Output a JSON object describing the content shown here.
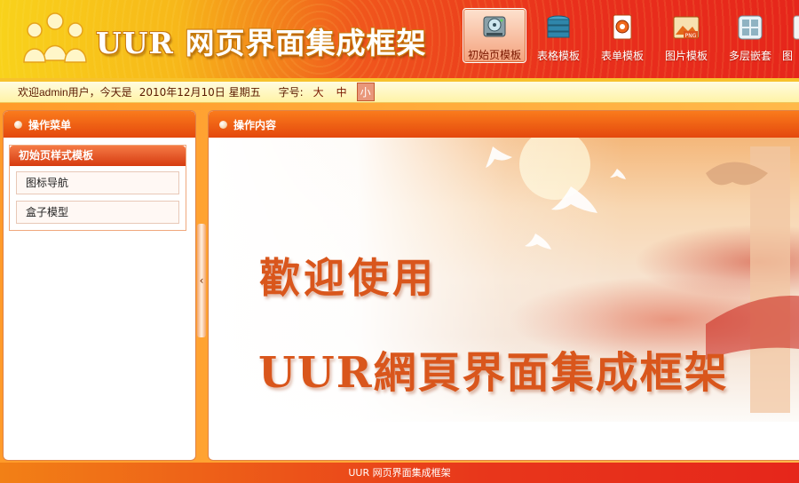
{
  "header": {
    "title": "UUR 网页界面集成框架",
    "nav": [
      {
        "label": "初始页模板",
        "icon": "disk-drive-icon",
        "active": true
      },
      {
        "label": "表格模板",
        "icon": "database-stack-icon",
        "active": false
      },
      {
        "label": "表单模板",
        "icon": "settings-gear-icon",
        "active": false
      },
      {
        "label": "图片模板",
        "icon": "png-image-icon",
        "active": false
      },
      {
        "label": "多层嵌套",
        "icon": "grid-window-icon",
        "active": false
      },
      {
        "label": "图",
        "icon": "partial-icon",
        "active": false
      }
    ]
  },
  "infobar": {
    "welcome": "欢迎admin用户，今天是",
    "date": "2010年12月10日 星期五",
    "font_size_label": "字号:",
    "font_sizes": [
      "大",
      "中",
      "小"
    ],
    "selected_font_size": "小"
  },
  "sidebar": {
    "title": "操作菜单",
    "group_title": "初始页样式模板",
    "items": [
      "图标导航",
      "盒子模型"
    ]
  },
  "content": {
    "title": "操作内容",
    "banner_line1": "歡迎使用",
    "banner_line2": "UUR網頁界面集成框架"
  },
  "footer": {
    "text": "UUR 网页界面集成框架"
  },
  "colors": {
    "accent_orange": "#e4480d",
    "banner_text": "#d9561c",
    "header_yellow": "#f8d21b",
    "header_red": "#e6261b"
  }
}
